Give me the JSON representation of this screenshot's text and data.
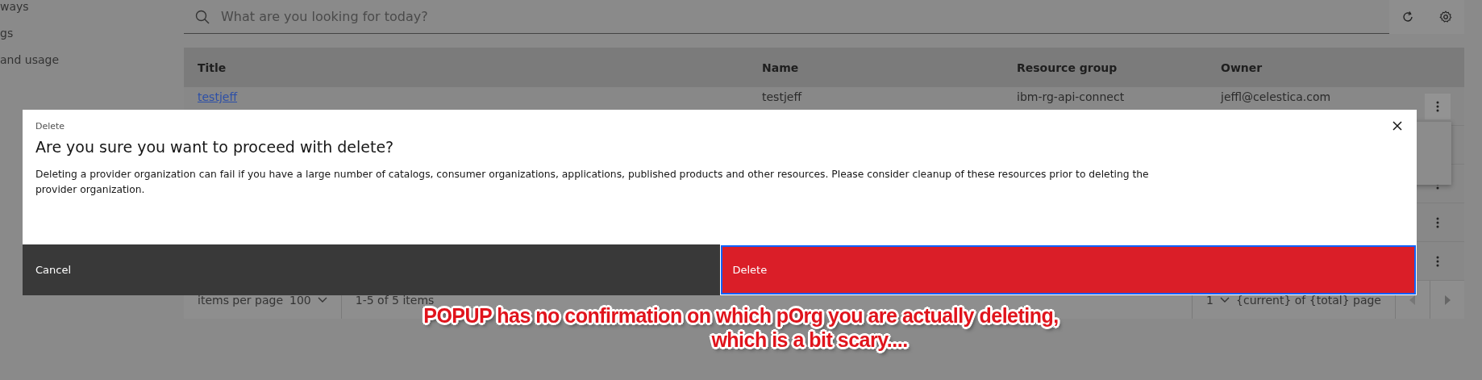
{
  "sidebar": {
    "items": [
      {
        "label": "ways"
      },
      {
        "label": "gs"
      },
      {
        "label": "and usage"
      }
    ]
  },
  "search": {
    "placeholder": "What are you looking for today?"
  },
  "table": {
    "columns": [
      "Title",
      "Name",
      "Resource group",
      "Owner"
    ],
    "rows": [
      {
        "cells": [
          "testjeff",
          "testjeff",
          "ibm-rg-api-connect",
          "jeffl@celestica.com"
        ]
      }
    ]
  },
  "pagination": {
    "items_per_page_label": "items per page",
    "items_per_page": "100",
    "range": "1-5 of 5 items",
    "page": "1",
    "page_label": "{current} of {total} page"
  },
  "dialog": {
    "label": "Delete",
    "title": "Are you sure you want to proceed with delete?",
    "body": "Deleting a provider organization can fail if you have a large number of catalogs, consumer organizations, applications, published products and other resources. Please consider cleanup of these resources prior to deleting the provider organization.",
    "buttons": [
      {
        "label": "Cancel",
        "kind": "secondary"
      },
      {
        "label": "Delete",
        "kind": "danger"
      }
    ]
  },
  "annotation": {
    "lines": [
      "POPUP has no confirmation on which pOrg you are actually deleting,",
      "which is a bit scary...."
    ]
  }
}
